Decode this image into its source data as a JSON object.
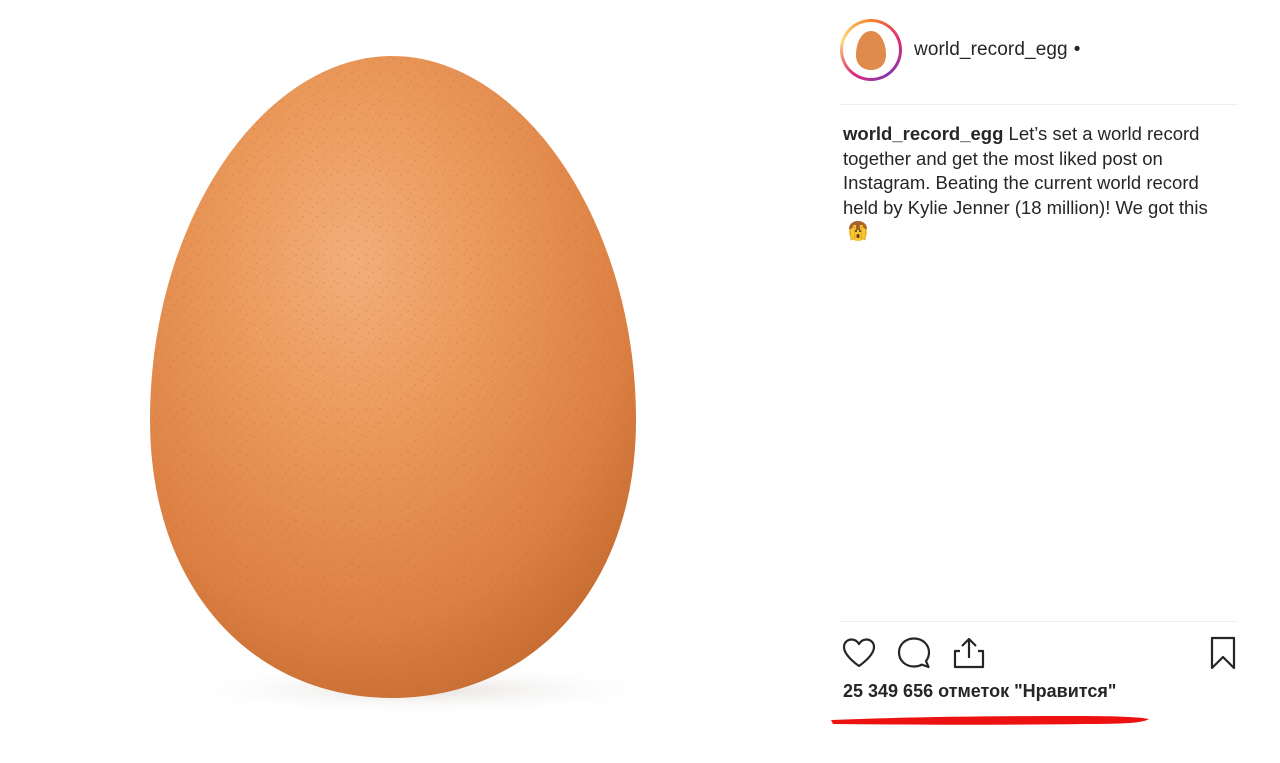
{
  "post": {
    "username": "world_record_egg",
    "dot": "•",
    "caption_author": "world_record_egg",
    "caption_text": "Let’s set a world record together and get the most liked post on Instagram. Beating the current world record held by Kylie Jenner (18 million)! We got this",
    "likes_text": "25 349 656 отметок \"Нравится\""
  },
  "icons": {
    "like": "heart-icon",
    "comment": "comment-icon",
    "share": "share-icon",
    "save": "bookmark-icon",
    "emoji": "face-with-hands-emoji"
  },
  "colors": {
    "egg": "#e58a4a",
    "annotation": "#ee1111",
    "text": "#262626",
    "divider": "#efefef"
  }
}
